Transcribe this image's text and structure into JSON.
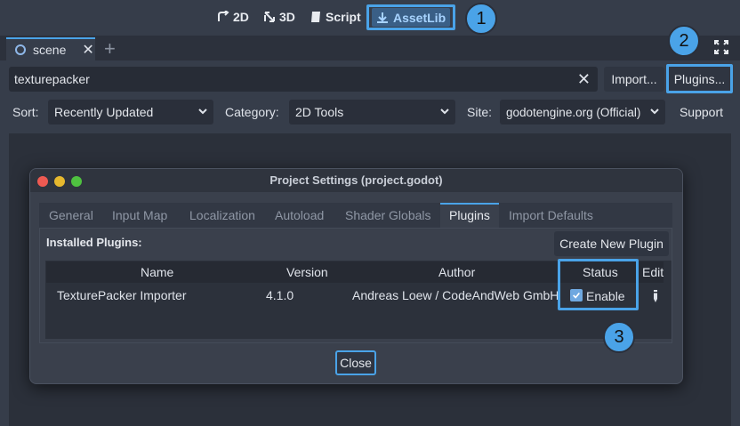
{
  "workspace": {
    "items": [
      {
        "label": "2D"
      },
      {
        "label": "3D"
      },
      {
        "label": "Script"
      },
      {
        "label": "AssetLib"
      }
    ]
  },
  "steps": [
    "1",
    "2",
    "3"
  ],
  "tabs": {
    "scene_label": "scene",
    "add_symbol": "+"
  },
  "search": {
    "value": "texturepacker",
    "clear": "✕"
  },
  "buttons": {
    "import": "Import...",
    "plugins": "Plugins...",
    "support": "Support"
  },
  "filters": {
    "sort_label": "Sort:",
    "sort_value": "Recently Updated",
    "category_label": "Category:",
    "category_value": "2D Tools",
    "site_label": "Site:",
    "site_value": "godotengine.org (Official)"
  },
  "dialog": {
    "title": "Project Settings (project.godot)",
    "tabs": [
      "General",
      "Input Map",
      "Localization",
      "Autoload",
      "Shader Globals",
      "Plugins",
      "Import Defaults"
    ],
    "active_tab": "Plugins",
    "installed_label": "Installed Plugins:",
    "create_button": "Create New Plugin",
    "columns": [
      "Name",
      "Version",
      "Author",
      "Status",
      "Edit"
    ],
    "rows": [
      {
        "name": "TexturePacker Importer",
        "version": "4.1.0",
        "author": "Andreas Loew / CodeAndWeb GmbH",
        "status": "Enable",
        "enabled": true
      }
    ],
    "close_button": "Close"
  },
  "colors": {
    "accent": "#4aa3e8",
    "background": "#363d4a",
    "panel": "#2b303a"
  },
  "icons": [
    "2d-icon",
    "3d-icon",
    "script-icon",
    "assetlib-download-icon",
    "scene-ring-icon",
    "fullscreen-icon",
    "chevron-down-icon",
    "checkbox-checked-icon",
    "pencil-edit-icon"
  ]
}
